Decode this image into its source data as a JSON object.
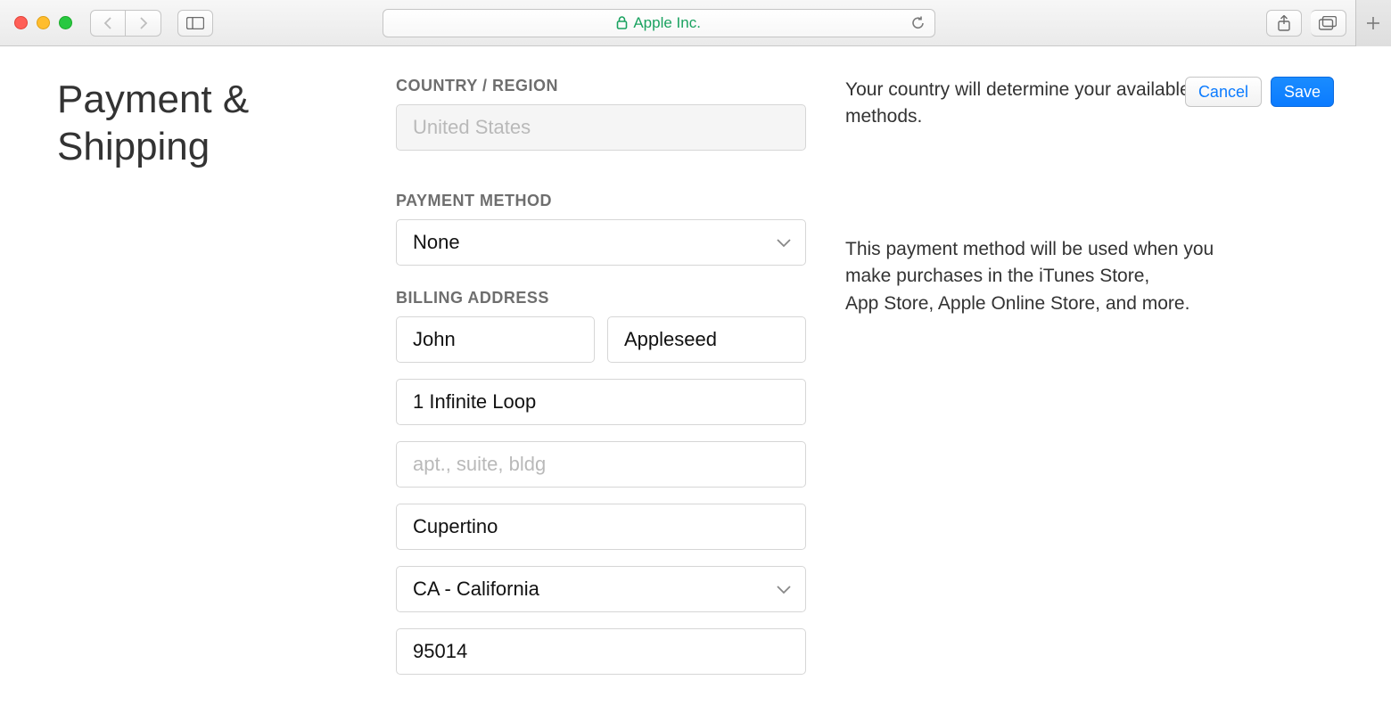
{
  "chrome": {
    "address_label": "Apple Inc."
  },
  "page": {
    "title_line1": "Payment &",
    "title_line2": "Shipping"
  },
  "country_region": {
    "label": "COUNTRY / REGION",
    "value": "United States",
    "help": "Your country will determine your available methods."
  },
  "payment_method": {
    "label": "PAYMENT METHOD",
    "value": "None",
    "help": "This payment method will be used when you make purchases in the iTunes Store, App Store, Apple Online Store, and more."
  },
  "billing": {
    "label": "BILLING ADDRESS",
    "first_name": "John",
    "last_name": "Appleseed",
    "street1": "1 Infinite Loop",
    "street2_placeholder": "apt., suite, bldg",
    "city": "Cupertino",
    "state": "CA - California",
    "zip": "95014"
  },
  "actions": {
    "cancel": "Cancel",
    "save": "Save"
  }
}
